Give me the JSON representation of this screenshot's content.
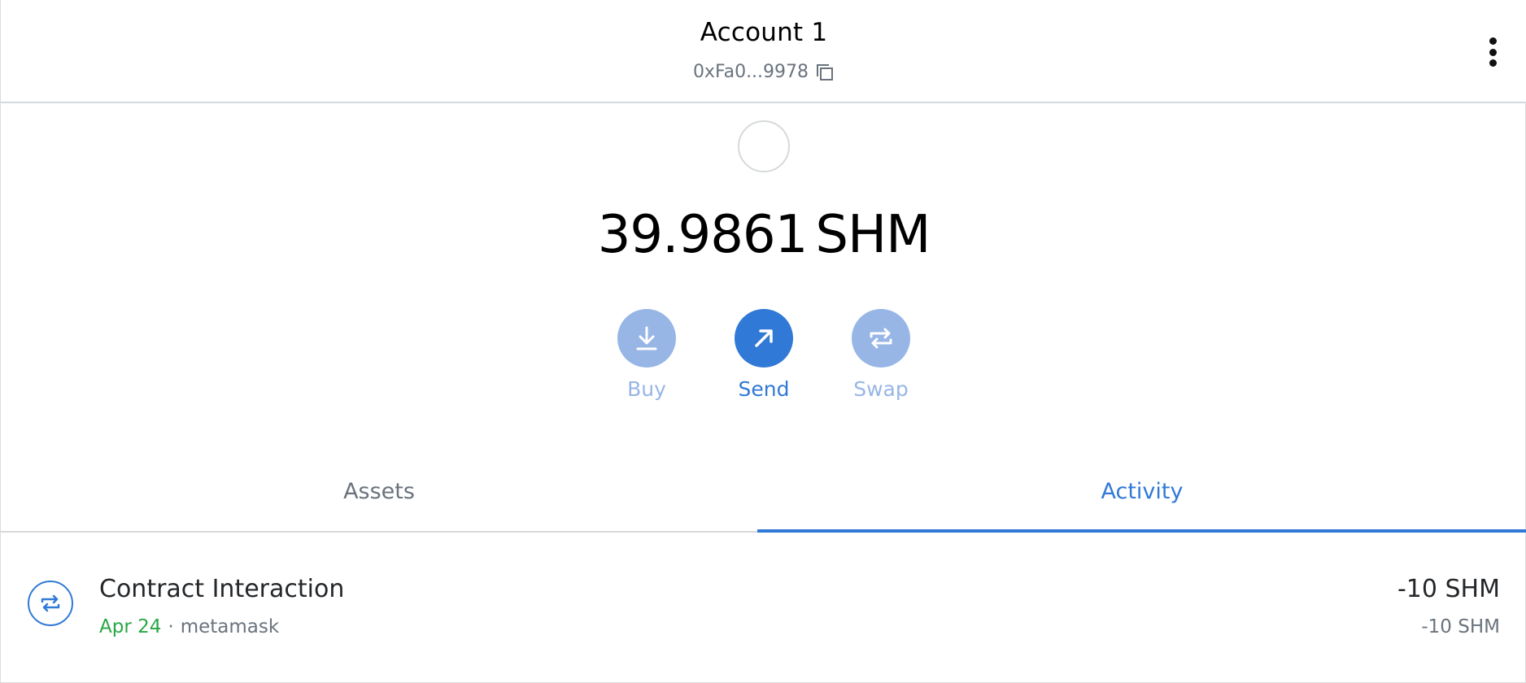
{
  "header": {
    "account_name": "Account 1",
    "address": "0xFa0...9978",
    "copy_icon": "copy-icon",
    "menu_icon": "kebab-menu-icon"
  },
  "balance": {
    "amount": "39.9861",
    "symbol": "SHM"
  },
  "actions": [
    {
      "label": "Buy",
      "icon": "download-icon",
      "state": "disabled"
    },
    {
      "label": "Send",
      "icon": "arrow-up-right-icon",
      "state": "enabled"
    },
    {
      "label": "Swap",
      "icon": "swap-icon",
      "state": "disabled"
    }
  ],
  "tabs": [
    {
      "label": "Assets",
      "active": false
    },
    {
      "label": "Activity",
      "active": true
    }
  ],
  "activity": [
    {
      "title": "Contract Interaction",
      "date": "Apr 24",
      "separator": "·",
      "origin": "metamask",
      "amount": "-10 SHM",
      "secondary_amount": "-10 SHM",
      "icon": "swap-icon"
    }
  ],
  "colors": {
    "accent": "#3179d6",
    "accent_disabled": "#97b6e6",
    "success": "#28a745",
    "muted": "#6a737d"
  }
}
